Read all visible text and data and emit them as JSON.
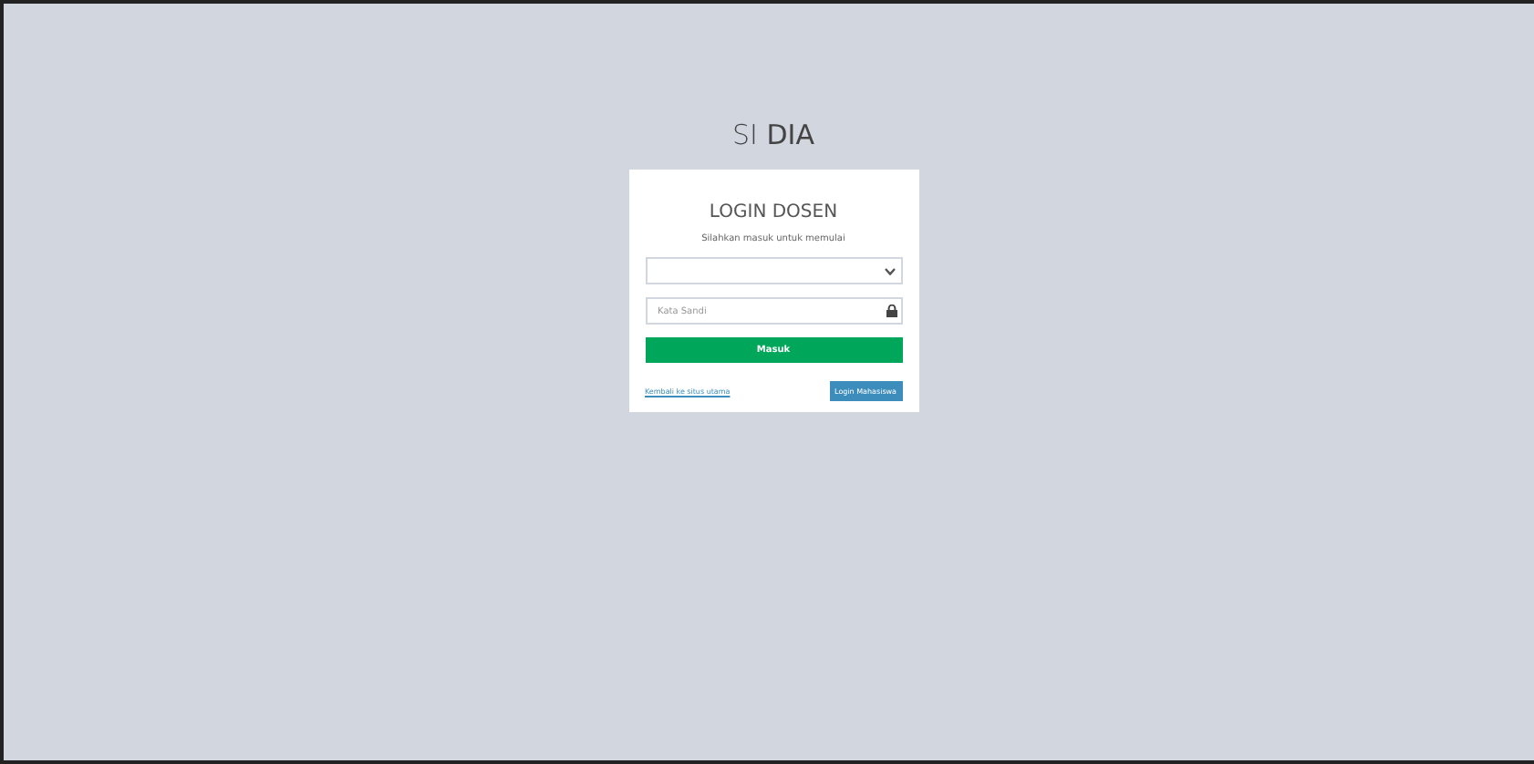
{
  "logo": "SI **DIA**",
  "card": {
    "title": "LOGIN DOSEN",
    "subtitle": "Silahkan masuk untuk memulai",
    "password": {
      "placeholder": "Kata Sandi"
    },
    "submit": "Masuk",
    "back_link": "Kembali ke situs utama",
    "alt_login": "Login Mahasiswa"
  }
}
